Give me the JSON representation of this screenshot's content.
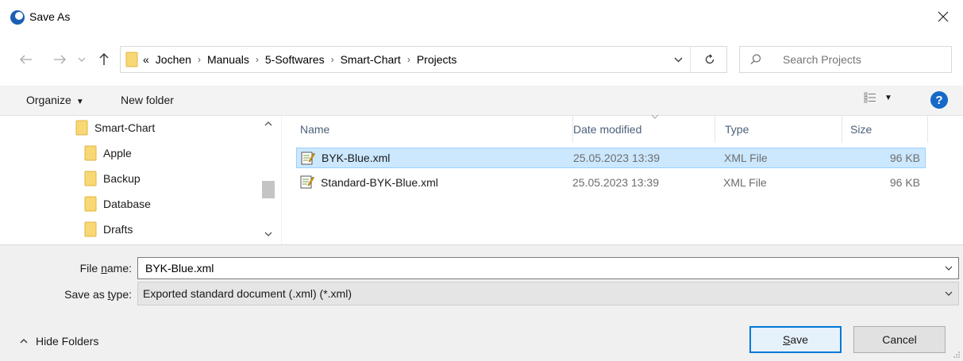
{
  "window": {
    "title": "Save As",
    "icon": "app-circle-icon",
    "close_glyph": "✕"
  },
  "nav": {
    "back": "←",
    "forward": "→",
    "recent": "⌄",
    "up": "↑",
    "overflow": "«",
    "breadcrumbs": [
      "Jochen",
      "Manuals",
      "5-Softwares",
      "Smart-Chart",
      "Projects"
    ],
    "refresh": "↻"
  },
  "search": {
    "placeholder": "Search Projects"
  },
  "toolbar": {
    "organize": "Organize",
    "new_folder": "New folder",
    "help": "?"
  },
  "tree": [
    {
      "label": "Smart-Chart",
      "level": 0
    },
    {
      "label": "Apple",
      "level": 1
    },
    {
      "label": "Backup",
      "level": 1
    },
    {
      "label": "Database",
      "level": 1
    },
    {
      "label": "Drafts",
      "level": 1
    }
  ],
  "columns": {
    "name": "Name",
    "date": "Date modified",
    "type": "Type",
    "size": "Size"
  },
  "files": [
    {
      "name": "BYK-Blue.xml",
      "date": "25.05.2023 13:39",
      "type": "XML File",
      "size": "96 KB",
      "selected": true
    },
    {
      "name": "Standard-BYK-Blue.xml",
      "date": "25.05.2023 13:39",
      "type": "XML File",
      "size": "96 KB",
      "selected": false
    }
  ],
  "form": {
    "file_name_label_pre": "File ",
    "file_name_label_u": "n",
    "file_name_label_post": "ame:",
    "file_name_value": "BYK-Blue.xml",
    "type_label_pre": "Save as ",
    "type_label_u": "t",
    "type_label_post": "ype:",
    "type_value": "Exported standard document (.xml) (*.xml)"
  },
  "footer": {
    "hide_folders": "Hide Folders",
    "save_u": "S",
    "save_rest": "ave",
    "cancel": "Cancel"
  },
  "colors": {
    "accent": "#0078d7",
    "selection": "#cce8ff",
    "folder": "#f8d775",
    "help": "#1669c8"
  }
}
